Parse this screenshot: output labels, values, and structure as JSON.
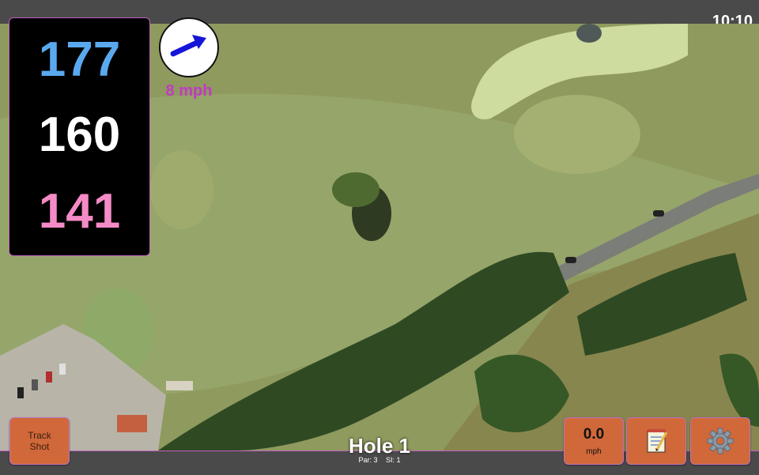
{
  "status": {
    "clock": "10:10"
  },
  "distances": {
    "back": "177",
    "middle": "160",
    "front": "141"
  },
  "wind": {
    "speed": "8 mph",
    "direction_icon": "wind-arrow-icon"
  },
  "hole": {
    "title": "Hole 1",
    "par": "Par: 3",
    "stroke_index": "SI: 1"
  },
  "buttons": {
    "track_shot_line1": "Track",
    "track_shot_line2": "Shot",
    "speed_value": "0.0",
    "speed_unit": "mph",
    "notes_icon": "notepad-icon",
    "settings_icon": "gear-icon"
  },
  "colors": {
    "back": "#5aa9ef",
    "middle": "#ffffff",
    "front": "#f48bc6",
    "wind_text": "#c23ac2",
    "button": "#d1683a",
    "accent_border": "#c060c0"
  }
}
